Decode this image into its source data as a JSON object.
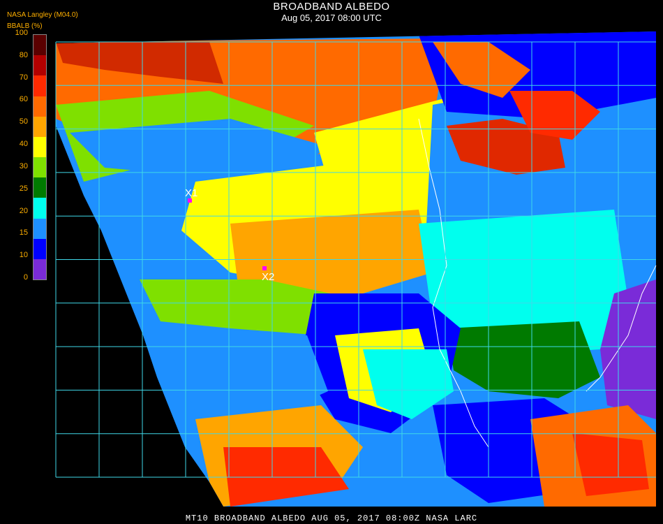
{
  "header": {
    "title": "BROADBAND ALBEDO",
    "subtitle": "Aug 05, 2017 08:00 UTC",
    "organization": "NASA Langley (M04.0)",
    "parameter_label": "BBALB (%)"
  },
  "colorbar": {
    "ticks": [
      "100",
      "80",
      "70",
      "60",
      "50",
      "40",
      "30",
      "25",
      "20",
      "15",
      "10",
      "0"
    ],
    "colors": [
      "#5a0000",
      "#b30000",
      "#ff2a00",
      "#ff6a00",
      "#ffa500",
      "#ffff00",
      "#7fe000",
      "#007a00",
      "#00ffee",
      "#1e90ff",
      "#0000ff",
      "#7a2bd8"
    ]
  },
  "markers": [
    {
      "label": "X1",
      "color": "#ff00ff"
    },
    {
      "label": "X2",
      "color": "#ff00ff"
    }
  ],
  "footer": "MT10  BROADBAND ALBEDO   AUG 05, 2017 08:00Z   NASA LARC"
}
